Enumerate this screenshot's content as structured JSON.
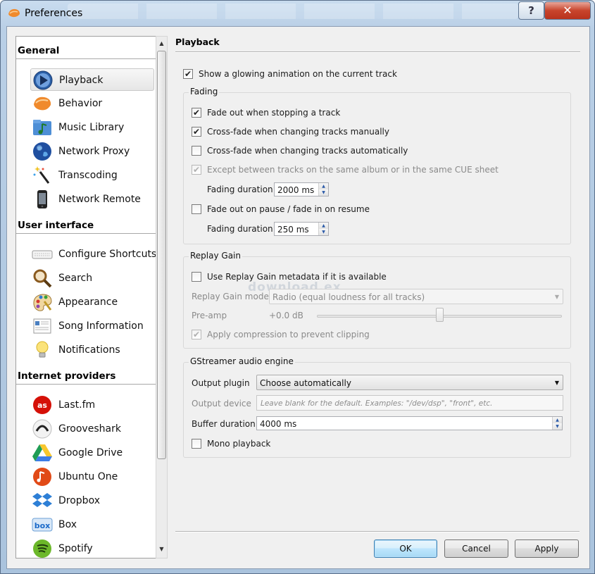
{
  "window": {
    "title": "Preferences",
    "help_glyph": "?",
    "close_glyph": "✕"
  },
  "sidebar": {
    "sections": [
      {
        "title": "General",
        "items": [
          {
            "label": "Playback",
            "icon": "play-icon",
            "selected": true
          },
          {
            "label": "Behavior",
            "icon": "clementine-icon"
          },
          {
            "label": "Music Library",
            "icon": "music-folder-icon"
          },
          {
            "label": "Network Proxy",
            "icon": "globe-icon"
          },
          {
            "label": "Transcoding",
            "icon": "magic-wand-icon"
          },
          {
            "label": "Network Remote",
            "icon": "phone-icon"
          }
        ]
      },
      {
        "title": "User interface",
        "items": [
          {
            "label": "Configure Shortcuts",
            "icon": "keyboard-icon"
          },
          {
            "label": "Search",
            "icon": "magnifier-icon"
          },
          {
            "label": "Appearance",
            "icon": "palette-icon"
          },
          {
            "label": "Song Information",
            "icon": "document-icon"
          },
          {
            "label": "Notifications",
            "icon": "lightbulb-icon"
          }
        ]
      },
      {
        "title": "Internet providers",
        "items": [
          {
            "label": "Last.fm",
            "icon": "lastfm-icon"
          },
          {
            "label": "Grooveshark",
            "icon": "grooveshark-icon"
          },
          {
            "label": "Google Drive",
            "icon": "google-drive-icon"
          },
          {
            "label": "Ubuntu One",
            "icon": "ubuntu-one-icon"
          },
          {
            "label": "Dropbox",
            "icon": "dropbox-icon"
          },
          {
            "label": "Box",
            "icon": "box-icon"
          },
          {
            "label": "Spotify",
            "icon": "spotify-icon"
          }
        ]
      }
    ]
  },
  "page": {
    "title": "Playback",
    "glow": {
      "label": "Show a glowing animation on the current track",
      "checked": true
    },
    "fading": {
      "title": "Fading",
      "fade_out_stop": {
        "label": "Fade out when stopping a track",
        "checked": true
      },
      "crossfade_manual": {
        "label": "Cross-fade when changing tracks manually",
        "checked": true
      },
      "crossfade_auto": {
        "label": "Cross-fade when changing tracks automatically",
        "checked": false
      },
      "except_album": {
        "label": "Except between tracks on the same album or in the same CUE sheet",
        "checked": true,
        "disabled": true
      },
      "fading_duration_label": "Fading duration",
      "fading_duration_value": "2000 ms",
      "fade_pause": {
        "label": "Fade out on pause / fade in on resume",
        "checked": false
      },
      "pause_duration_label": "Fading duration",
      "pause_duration_value": "250 ms"
    },
    "replay_gain": {
      "title": "Replay Gain",
      "use_metadata": {
        "label": "Use Replay Gain metadata if it is available",
        "checked": false
      },
      "mode_label": "Replay Gain mode",
      "mode_value": "Radio (equal loudness for all tracks)",
      "preamp_label": "Pre-amp",
      "preamp_value": "+0.0 dB",
      "preamp_level": 0.5,
      "compression": {
        "label": "Apply compression to prevent clipping",
        "checked": true,
        "disabled": true
      }
    },
    "gstreamer": {
      "title": "GStreamer audio engine",
      "output_plugin_label": "Output plugin",
      "output_plugin_value": "Choose automatically",
      "output_device_label": "Output device",
      "output_device_placeholder": "Leave blank for the default.  Examples: \"/dev/dsp\", \"front\", etc.",
      "buffer_label": "Buffer duration",
      "buffer_value": "4000 ms",
      "mono": {
        "label": "Mono playback",
        "checked": false
      }
    }
  },
  "buttons": {
    "ok": "OK",
    "cancel": "Cancel",
    "apply": "Apply"
  },
  "watermark": "download.ex"
}
